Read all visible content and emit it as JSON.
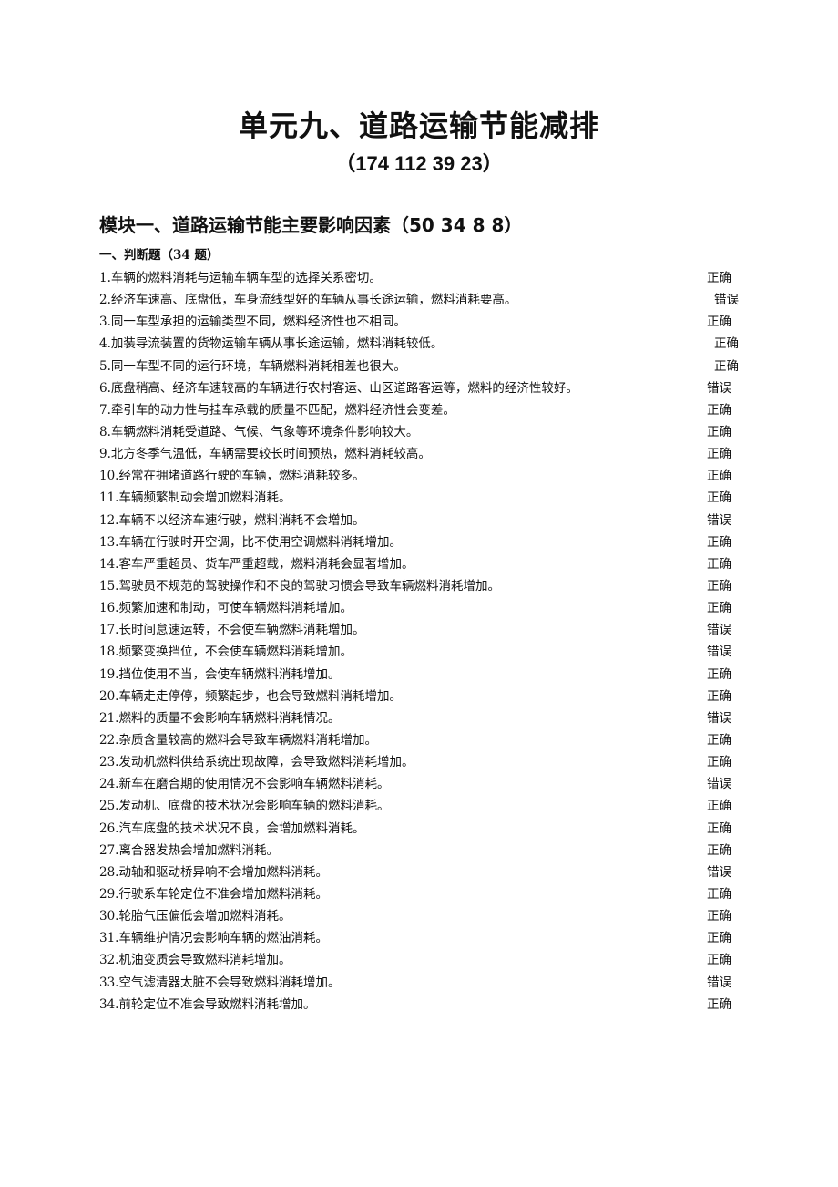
{
  "document": {
    "title": "单元九、道路运输节能减排",
    "subtitle": "（174 112 39 23）",
    "module_title": "模块一、道路运输节能主要影响因素（50 34 8 8）",
    "section_title": "一、判断题（34 题）",
    "questions": [
      {
        "text": "1.车辆的燃料消耗与运输车辆车型的选择关系密切。",
        "answer": "正确"
      },
      {
        "text": "2.经济车速高、底盘低，车身流线型好的车辆从事长途运输，燃料消耗要高。",
        "answer": "错误"
      },
      {
        "text": "3.同一车型承担的运输类型不同，燃料经济性也不相同。",
        "answer": "正确"
      },
      {
        "text": "4.加装导流装置的货物运输车辆从事长途运输，燃料消耗较低。",
        "answer": "正确"
      },
      {
        "text": "5.同一车型不同的运行环境，车辆燃料消耗相差也很大。",
        "answer": "正确"
      },
      {
        "text": "6.底盘稍高、经济车速较高的车辆进行农村客运、山区道路客运等，燃料的经济性较好。",
        "answer": "错误"
      },
      {
        "text": "7.牵引车的动力性与挂车承载的质量不匹配，燃料经济性会变差。",
        "answer": "正确"
      },
      {
        "text": "8.车辆燃料消耗受道路、气候、气象等环境条件影响较大。",
        "answer": "正确"
      },
      {
        "text": "9.北方冬季气温低，车辆需要较长时间预热，燃料消耗较高。",
        "answer": "正确"
      },
      {
        "text": "10.经常在拥堵道路行驶的车辆，燃料消耗较多。",
        "answer": "正确"
      },
      {
        "text": "11.车辆频繁制动会增加燃料消耗。",
        "answer": "正确"
      },
      {
        "text": "12.车辆不以经济车速行驶，燃料消耗不会增加。",
        "answer": "错误"
      },
      {
        "text": "13.车辆在行驶时开空调，比不使用空调燃料消耗增加。",
        "answer": "正确"
      },
      {
        "text": "14.客车严重超员、货车严重超载，燃料消耗会显著增加。",
        "answer": "正确"
      },
      {
        "text": "15.驾驶员不规范的驾驶操作和不良的驾驶习惯会导致车辆燃料消耗增加。",
        "answer": "正确"
      },
      {
        "text": "16.频繁加速和制动，可使车辆燃料消耗增加。",
        "answer": "正确"
      },
      {
        "text": "17.长时间怠速运转，不会使车辆燃料消耗增加。",
        "answer": "错误"
      },
      {
        "text": "18.频繁变换挡位，不会使车辆燃料消耗增加。",
        "answer": "错误"
      },
      {
        "text": "19.挡位使用不当，会使车辆燃料消耗增加。",
        "answer": "正确"
      },
      {
        "text": "20.车辆走走停停，频繁起步，也会导致燃料消耗增加。",
        "answer": "正确"
      },
      {
        "text": "21.燃料的质量不会影响车辆燃料消耗情况。",
        "answer": "错误"
      },
      {
        "text": "22.杂质含量较高的燃料会导致车辆燃料消耗增加。",
        "answer": "正确"
      },
      {
        "text": "23.发动机燃料供给系统出现故障，会导致燃料消耗增加。",
        "answer": "正确"
      },
      {
        "text": "24.新车在磨合期的使用情况不会影响车辆燃料消耗。",
        "answer": "错误"
      },
      {
        "text": "25.发动机、底盘的技术状况会影响车辆的燃料消耗。",
        "answer": "正确"
      },
      {
        "text": "26.汽车底盘的技术状况不良，会增加燃料消耗。",
        "answer": "正确"
      },
      {
        "text": "27.离合器发热会增加燃料消耗。",
        "answer": "正确"
      },
      {
        "text": "28.动轴和驱动桥异响不会增加燃料消耗。",
        "answer": "错误"
      },
      {
        "text": "29.行驶系车轮定位不准会增加燃料消耗。",
        "answer": "正确"
      },
      {
        "text": "30.轮胎气压偏低会增加燃料消耗。",
        "answer": "正确"
      },
      {
        "text": "31.车辆维护情况会影响车辆的燃油消耗。",
        "answer": "正确"
      },
      {
        "text": "32.机油变质会导致燃料消耗增加。",
        "answer": "正确"
      },
      {
        "text": "33.空气滤清器太脏不会导致燃料消耗增加。",
        "answer": "错误"
      },
      {
        "text": "34.前轮定位不准会导致燃料消耗增加。",
        "answer": "正确"
      }
    ]
  }
}
